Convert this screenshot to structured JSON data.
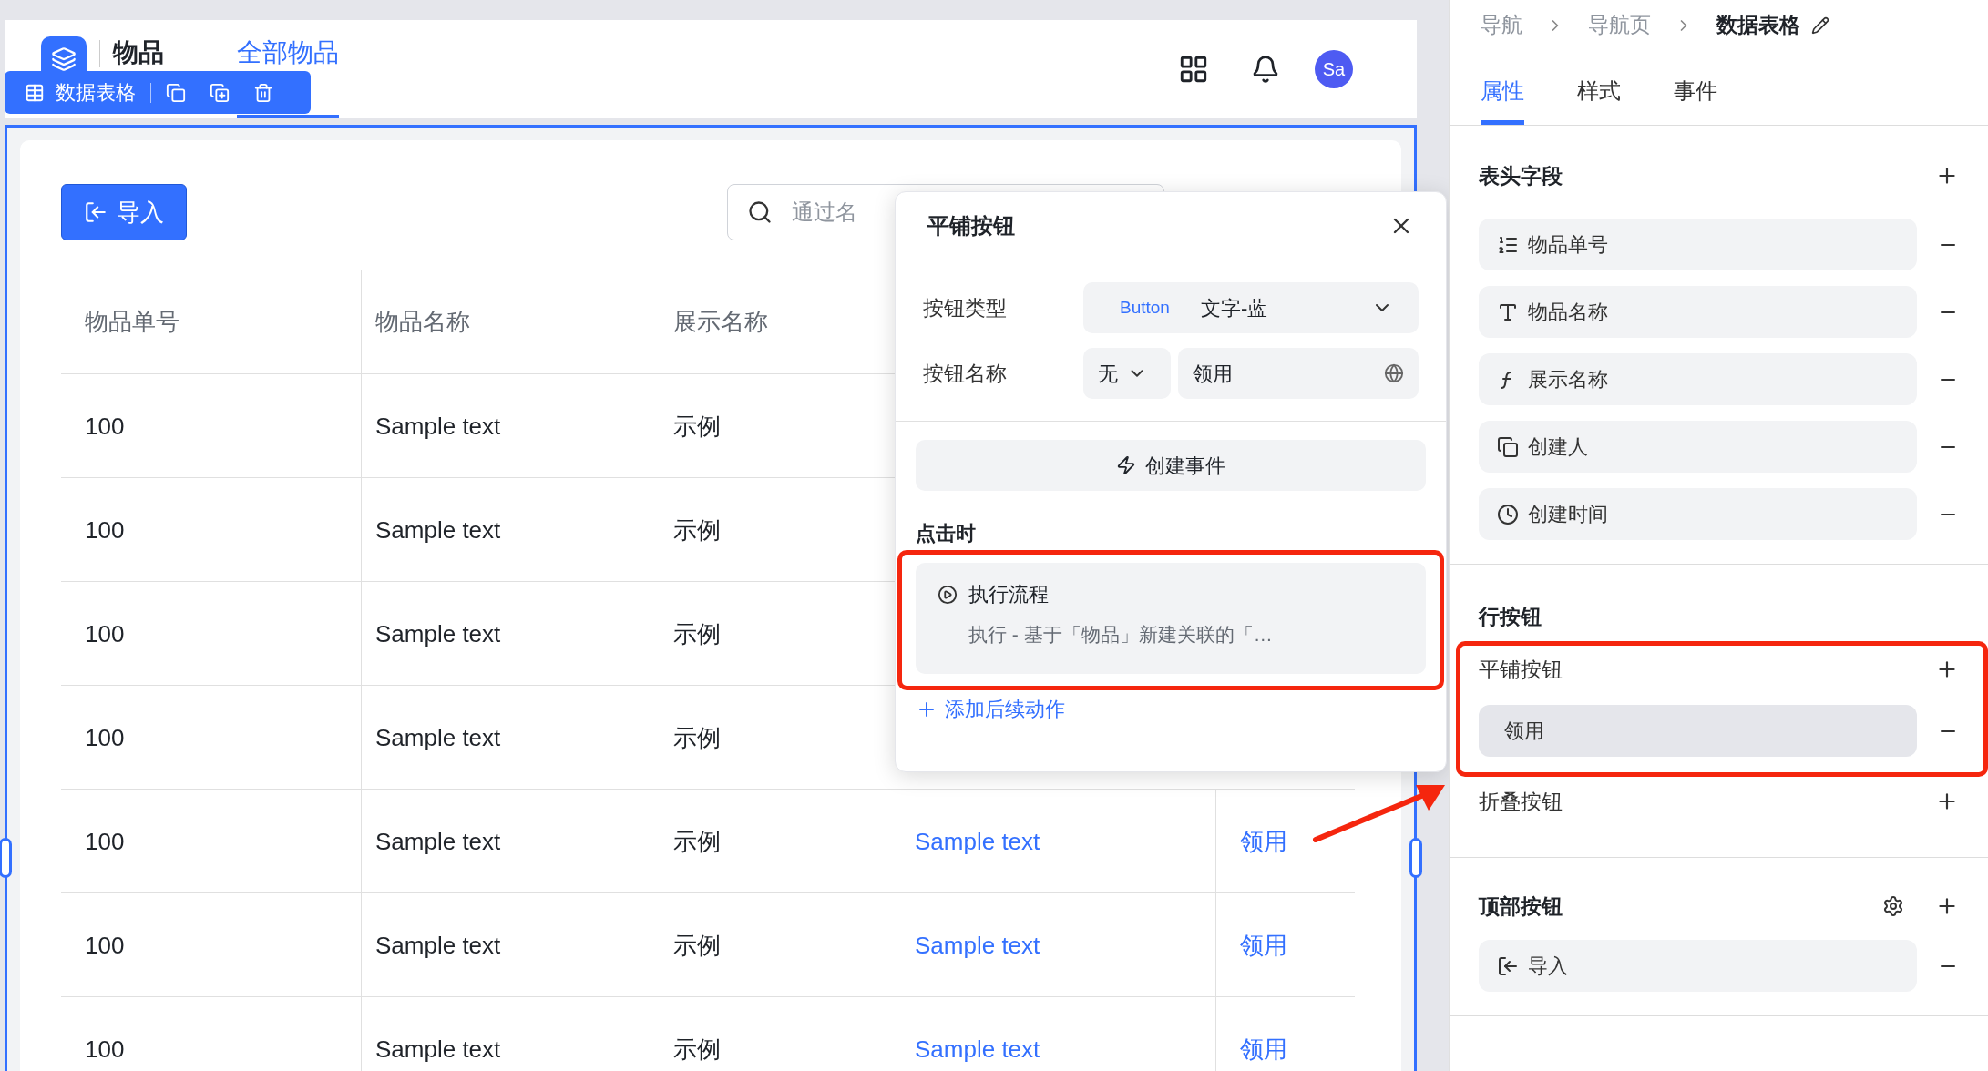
{
  "app_header": {
    "title": "物品",
    "tabs": [
      {
        "label": "全部物品",
        "selected": true
      }
    ],
    "avatar": "Sa"
  },
  "component_toolbar": {
    "label": "数据表格"
  },
  "table_toolbar": {
    "import_button": "导入",
    "search": {
      "placeholder": "通过名"
    }
  },
  "table": {
    "columns": [
      "物品单号",
      "物品名称",
      "展示名称"
    ],
    "rows": [
      {
        "cells": [
          {
            "text": "100",
            "kind": "text"
          },
          {
            "text": "Sample text",
            "kind": "text"
          },
          {
            "text": "示例",
            "kind": "text"
          }
        ]
      },
      {
        "cells": [
          {
            "text": "100",
            "kind": "text"
          },
          {
            "text": "Sample text",
            "kind": "text"
          },
          {
            "text": "示例",
            "kind": "text"
          }
        ]
      },
      {
        "cells": [
          {
            "text": "100",
            "kind": "text"
          },
          {
            "text": "Sample text",
            "kind": "text"
          },
          {
            "text": "示例",
            "kind": "text"
          }
        ]
      },
      {
        "cells": [
          {
            "text": "100",
            "kind": "text"
          },
          {
            "text": "Sample text",
            "kind": "text"
          },
          {
            "text": "示例",
            "kind": "text"
          }
        ]
      },
      {
        "cells": [
          {
            "text": "100",
            "kind": "text"
          },
          {
            "text": "Sample text",
            "kind": "text"
          },
          {
            "text": "示例",
            "kind": "text"
          },
          {
            "text": "Sample text",
            "kind": "link"
          },
          {
            "text": "领用",
            "kind": "link"
          }
        ]
      },
      {
        "cells": [
          {
            "text": "100",
            "kind": "text"
          },
          {
            "text": "Sample text",
            "kind": "text"
          },
          {
            "text": "示例",
            "kind": "text"
          },
          {
            "text": "Sample text",
            "kind": "link"
          },
          {
            "text": "领用",
            "kind": "link"
          }
        ]
      },
      {
        "cells": [
          {
            "text": "100",
            "kind": "text"
          },
          {
            "text": "Sample text",
            "kind": "text"
          },
          {
            "text": "示例",
            "kind": "text"
          },
          {
            "text": "Sample text",
            "kind": "link"
          },
          {
            "text": "领用",
            "kind": "link"
          }
        ]
      }
    ]
  },
  "popup": {
    "title": "平铺按钮",
    "button_type": {
      "label": "按钮类型",
      "tag": "Button",
      "value": "文字-蓝"
    },
    "button_name": {
      "label": "按钮名称",
      "prefix": "无",
      "value": "领用"
    },
    "create_event_button": "创建事件",
    "on_click_label": "点击时",
    "action": {
      "title": "执行流程",
      "description": "执行 - 基于「物品」新建关联的「…",
      "highlighted": true
    },
    "add_action_link": "添加后续动作"
  },
  "properties_panel": {
    "breadcrumb": [
      {
        "label": "导航",
        "current": false
      },
      {
        "label": "导航页",
        "current": false
      },
      {
        "label": "数据表格",
        "current": true
      }
    ],
    "tabs": [
      {
        "label": "属性",
        "selected": true
      },
      {
        "label": "样式",
        "selected": false
      },
      {
        "label": "事件",
        "selected": false
      }
    ],
    "header_fields": {
      "title": "表头字段",
      "items": [
        {
          "label": "物品单号",
          "selected": false
        },
        {
          "label": "物品名称",
          "selected": false
        },
        {
          "label": "展示名称",
          "selected": false
        },
        {
          "label": "创建人",
          "selected": false
        },
        {
          "label": "创建时间",
          "selected": false
        }
      ]
    },
    "row_buttons": {
      "title": "行按钮",
      "groups": [
        {
          "title": "平铺按钮",
          "highlighted": true,
          "items": [
            {
              "label": "领用",
              "selected": true
            }
          ]
        },
        {
          "title": "折叠按钮",
          "highlighted": false
        }
      ]
    },
    "top_buttons": {
      "title": "顶部按钮",
      "items": [
        {
          "label": "导入",
          "selected": false
        }
      ]
    }
  }
}
